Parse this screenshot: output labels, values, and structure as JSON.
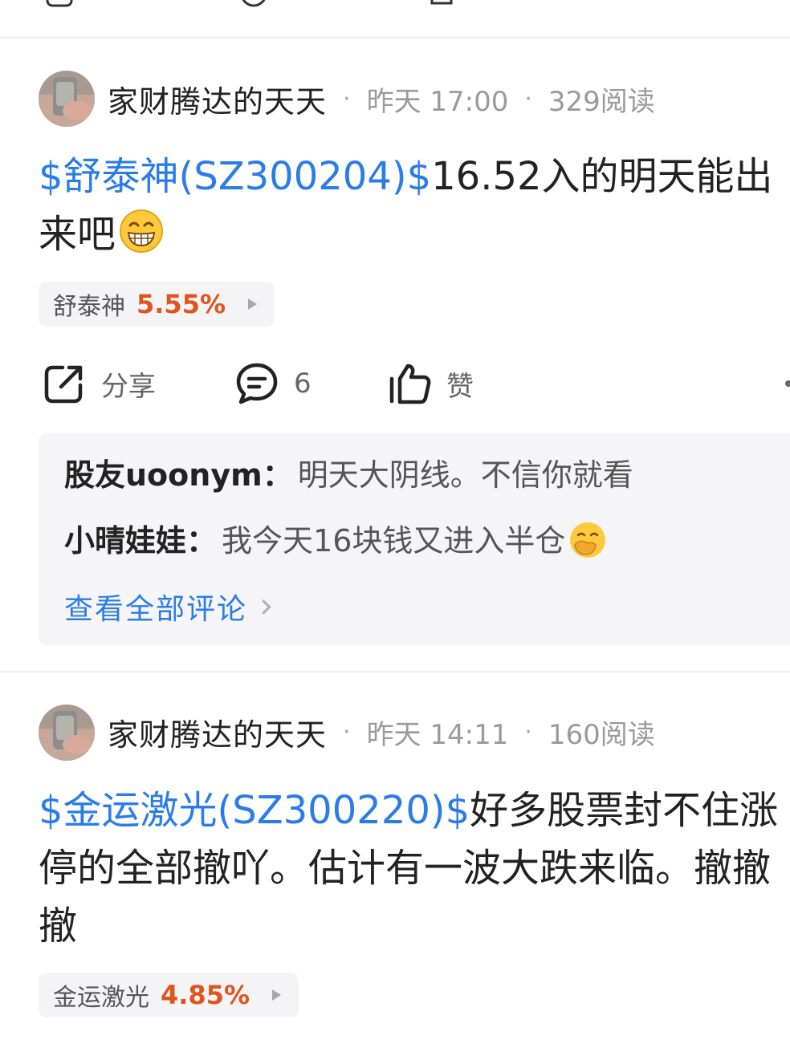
{
  "colors": {
    "link": "#2a7ce8",
    "gain": "#e0541d",
    "text_primary": "#222222",
    "text_meta": "#9a9a9a",
    "panel_bg": "#f5f5f7"
  },
  "posts": [
    {
      "author": "家财腾达的天天",
      "time": "昨天 17:00",
      "reads": "329阅读",
      "stock_link": "$舒泰神(SZ300204)$",
      "text_line1": "16.52入的明天能出",
      "text_line2": "来吧",
      "emoji": "grinning-face-emoji",
      "chip": {
        "name": "舒泰神",
        "change": "5.55%"
      },
      "actions": {
        "share_label": "分享",
        "comment_count": "6",
        "like_label": "赞"
      },
      "comments": [
        {
          "author": "股友uoonym",
          "colon": "：",
          "text": "明天大阴线。不信你就看"
        },
        {
          "author": "小晴娃娃",
          "colon": "：",
          "text": "我今天16块钱又进入半仓",
          "emoji": "hand-over-mouth-emoji"
        }
      ],
      "view_all_label": "查看全部评论"
    },
    {
      "author": "家财腾达的天天",
      "time": "昨天 14:11",
      "reads": "160阅读",
      "stock_link": "$金运激光(SZ300220)$",
      "text_line1": "好多股票封不住涨",
      "text_line2": "停的全部撤吖。估计有一波大跌来临。撤撤",
      "text_line3": "撤",
      "chip": {
        "name": "金运激光",
        "change": "4.85%"
      }
    }
  ]
}
